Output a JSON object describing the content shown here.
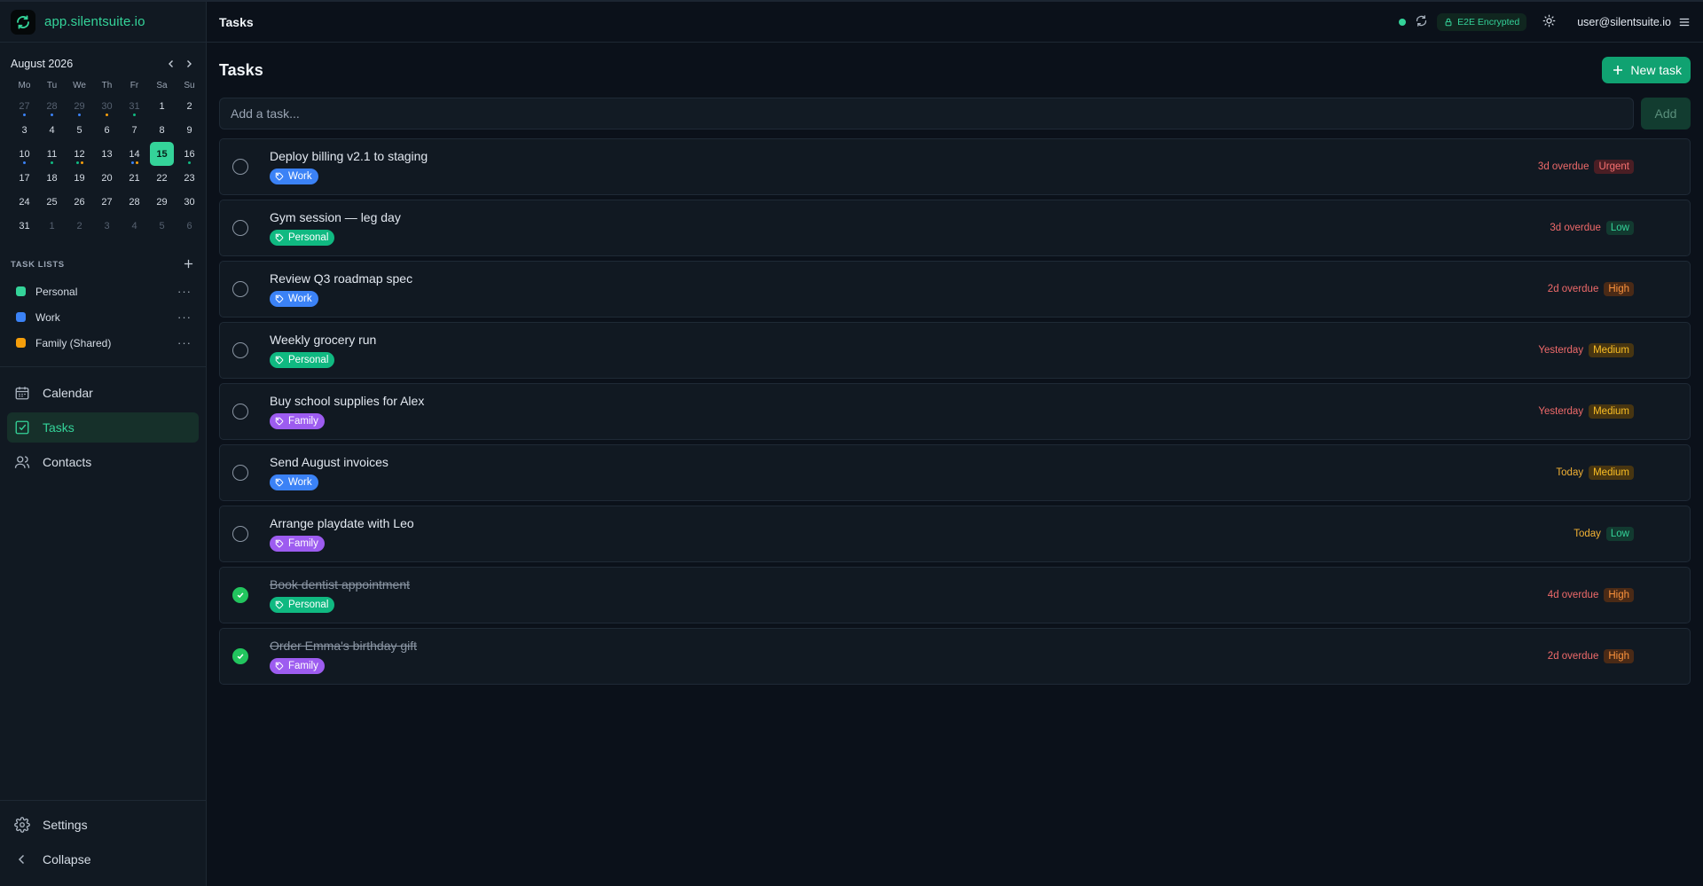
{
  "app": {
    "domain": "app.silentsuite.io"
  },
  "topbar": {
    "title": "Tasks",
    "encryption_label": "E2E Encrypted",
    "user": "user@silentsuite.io"
  },
  "calendar": {
    "month_label": "August 2026",
    "weekdays": [
      "Mo",
      "Tu",
      "We",
      "Th",
      "Fr",
      "Sa",
      "Su"
    ],
    "days": [
      {
        "d": "27",
        "muted": true,
        "dots": [
          "#3b82f6"
        ]
      },
      {
        "d": "28",
        "muted": true,
        "dots": [
          "#3b82f6"
        ]
      },
      {
        "d": "29",
        "muted": true,
        "dots": [
          "#3b82f6"
        ]
      },
      {
        "d": "30",
        "muted": true,
        "dots": [
          "#f59e0b"
        ]
      },
      {
        "d": "31",
        "muted": true,
        "dots": [
          "#10b981"
        ]
      },
      {
        "d": "1"
      },
      {
        "d": "2"
      },
      {
        "d": "3"
      },
      {
        "d": "4"
      },
      {
        "d": "5"
      },
      {
        "d": "6"
      },
      {
        "d": "7"
      },
      {
        "d": "8"
      },
      {
        "d": "9"
      },
      {
        "d": "10",
        "dots": [
          "#3b82f6"
        ]
      },
      {
        "d": "11",
        "dots": [
          "#10b981"
        ]
      },
      {
        "d": "12",
        "dots": [
          "#10b981",
          "#f59e0b"
        ]
      },
      {
        "d": "13"
      },
      {
        "d": "14",
        "dots": [
          "#3b82f6",
          "#f59e0b"
        ]
      },
      {
        "d": "15",
        "today": true
      },
      {
        "d": "16",
        "dots": [
          "#10b981"
        ]
      },
      {
        "d": "17"
      },
      {
        "d": "18"
      },
      {
        "d": "19"
      },
      {
        "d": "20"
      },
      {
        "d": "21"
      },
      {
        "d": "22"
      },
      {
        "d": "23"
      },
      {
        "d": "24"
      },
      {
        "d": "25"
      },
      {
        "d": "26"
      },
      {
        "d": "27"
      },
      {
        "d": "28"
      },
      {
        "d": "29"
      },
      {
        "d": "30"
      },
      {
        "d": "31"
      },
      {
        "d": "1",
        "muted": true
      },
      {
        "d": "2",
        "muted": true
      },
      {
        "d": "3",
        "muted": true
      },
      {
        "d": "4",
        "muted": true
      },
      {
        "d": "5",
        "muted": true
      },
      {
        "d": "6",
        "muted": true
      }
    ]
  },
  "task_lists": {
    "heading": "TASK LISTS",
    "items": [
      {
        "label": "Personal",
        "color": "#34d399"
      },
      {
        "label": "Work",
        "color": "#3b82f6"
      },
      {
        "label": "Family (Shared)",
        "color": "#f59e0b"
      }
    ]
  },
  "nav": {
    "calendar": "Calendar",
    "tasks": "Tasks",
    "contacts": "Contacts",
    "settings": "Settings",
    "collapse": "Collapse"
  },
  "page": {
    "title": "Tasks",
    "new_task": "New task",
    "add_placeholder": "Add a task...",
    "add_label": "Add"
  },
  "tasks": [
    {
      "title": "Deploy billing v2.1 to staging",
      "tag": "Work",
      "tag_class": "work",
      "due": "3d overdue",
      "due_class": "overdue",
      "priority": "Urgent",
      "prio_class": "urgent",
      "done": false
    },
    {
      "title": "Gym session — leg day",
      "tag": "Personal",
      "tag_class": "personal",
      "due": "3d overdue",
      "due_class": "overdue",
      "priority": "Low",
      "prio_class": "low",
      "done": false
    },
    {
      "title": "Review Q3 roadmap spec",
      "tag": "Work",
      "tag_class": "work",
      "due": "2d overdue",
      "due_class": "overdue",
      "priority": "High",
      "prio_class": "high",
      "done": false
    },
    {
      "title": "Weekly grocery run",
      "tag": "Personal",
      "tag_class": "personal",
      "due": "Yesterday",
      "due_class": "overdue",
      "priority": "Medium",
      "prio_class": "medium",
      "done": false
    },
    {
      "title": "Buy school supplies for Alex",
      "tag": "Family",
      "tag_class": "family",
      "due": "Yesterday",
      "due_class": "overdue",
      "priority": "Medium",
      "prio_class": "medium",
      "done": false
    },
    {
      "title": "Send August invoices",
      "tag": "Work",
      "tag_class": "work",
      "due": "Today",
      "due_class": "soon",
      "priority": "Medium",
      "prio_class": "medium",
      "done": false
    },
    {
      "title": "Arrange playdate with Leo",
      "tag": "Family",
      "tag_class": "family",
      "due": "Today",
      "due_class": "soon",
      "priority": "Low",
      "prio_class": "low",
      "done": false
    },
    {
      "title": "Book dentist appointment",
      "tag": "Personal",
      "tag_class": "personal",
      "due": "4d overdue",
      "due_class": "overdue",
      "priority": "High",
      "prio_class": "high",
      "done": true
    },
    {
      "title": "Order Emma's birthday gift",
      "tag": "Family",
      "tag_class": "family",
      "due": "2d overdue",
      "due_class": "overdue",
      "priority": "High",
      "prio_class": "high",
      "done": true
    }
  ]
}
